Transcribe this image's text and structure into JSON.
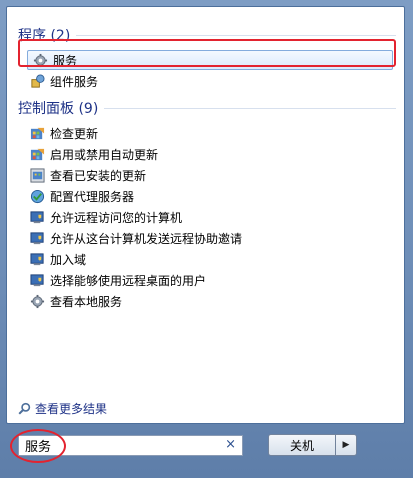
{
  "programs": {
    "title": "程序 (2)",
    "items": [
      {
        "label": "服务",
        "icon": "gear-icon"
      },
      {
        "label": "组件服务",
        "icon": "component-services-icon"
      }
    ]
  },
  "control_panel": {
    "title": "控制面板 (9)",
    "items": [
      {
        "label": "检查更新",
        "icon": "windows-update-icon"
      },
      {
        "label": "启用或禁用自动更新",
        "icon": "windows-update-icon"
      },
      {
        "label": "查看已安装的更新",
        "icon": "installed-updates-icon"
      },
      {
        "label": "配置代理服务器",
        "icon": "internet-options-icon"
      },
      {
        "label": "允许远程访问您的计算机",
        "icon": "system-shield-icon"
      },
      {
        "label": "允许从这台计算机发送远程协助邀请",
        "icon": "system-shield-icon"
      },
      {
        "label": "加入域",
        "icon": "system-shield-icon"
      },
      {
        "label": "选择能够使用远程桌面的用户",
        "icon": "system-shield-icon"
      },
      {
        "label": "查看本地服务",
        "icon": "gear-icon"
      }
    ]
  },
  "see_more": "查看更多结果",
  "search": {
    "value": "服务",
    "clear": "×"
  },
  "shutdown": {
    "label": "关机",
    "arrow": "▶"
  },
  "colors": {
    "highlight": "#e3232f",
    "group_title": "#1e3287"
  }
}
